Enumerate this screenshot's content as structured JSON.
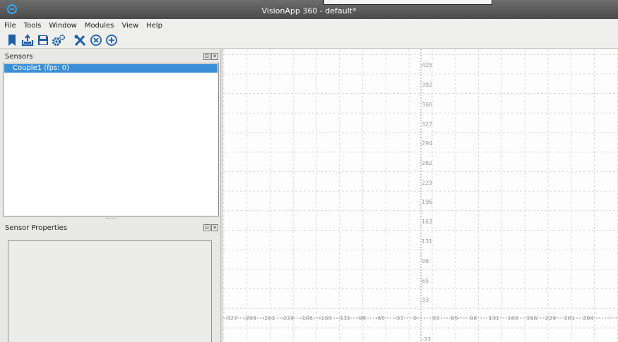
{
  "window": {
    "title": "VisionApp 360 - default*"
  },
  "menu": [
    "File",
    "Tools",
    "Window",
    "Modules",
    "View",
    "Help"
  ],
  "toolbar": {
    "buttons": [
      {
        "name": "new-icon",
        "color": "#1f5fa8"
      },
      {
        "name": "export-icon",
        "color": "#1f5fa8"
      },
      {
        "name": "save-icon",
        "color": "#1f5fa8"
      },
      {
        "name": "settings-icon",
        "color": "#1f5fa8"
      },
      {
        "name": "tools-icon",
        "color": "#1f5fa8"
      },
      {
        "name": "remove-icon",
        "color": "#1f5fa8"
      },
      {
        "name": "add-icon",
        "color": "#1f5fa8"
      }
    ]
  },
  "sensors_panel": {
    "title": "Sensors",
    "items": [
      "Couple1 (fps: 0)"
    ]
  },
  "properties_panel": {
    "title": "Sensor Properties"
  },
  "plot": {
    "x_ticks": [
      "-327",
      "-294",
      "-261",
      "-229",
      "-196",
      "-163",
      "-131",
      "-98",
      "-65",
      "-33",
      "0",
      "33",
      "65",
      "98",
      "131",
      "163",
      "196",
      "229",
      "261",
      "294"
    ],
    "y_ticks": [
      "425",
      "392",
      "360",
      "327",
      "294",
      "262",
      "229",
      "196",
      "163",
      "131",
      "98",
      "65",
      "33",
      "-33"
    ],
    "grid": true,
    "grid_color": "#d8d8d8",
    "axis_color": "#9a9a9a"
  },
  "colors": {
    "selection": "#3b8fd6",
    "accent": "#1f5fa8"
  }
}
